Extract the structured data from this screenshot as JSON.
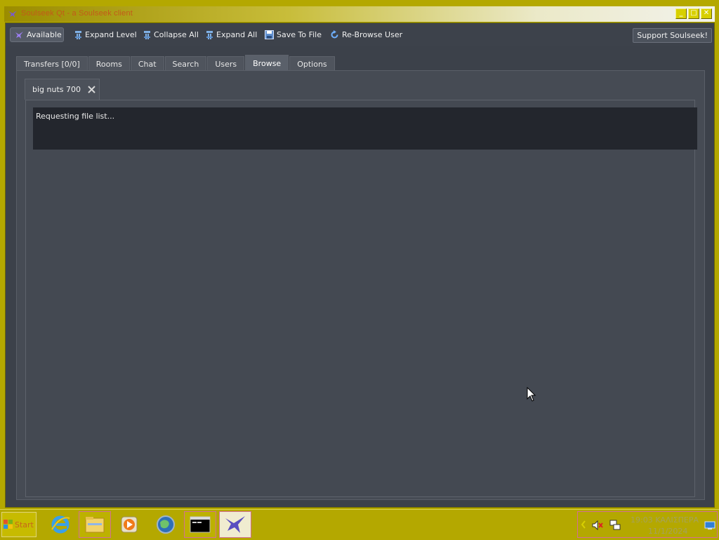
{
  "window": {
    "title": "Soulseek Qt - a Soulseek client",
    "min_label": "_",
    "max_label": "□",
    "close_label": "✕"
  },
  "toolbar": {
    "status_label": "Available",
    "expand_level": "Expand Level",
    "collapse_all": "Collapse All",
    "expand_all": "Expand All",
    "save_to_file": "Save To File",
    "rebrowse_user": "Re-Browse User",
    "support": "Support Soulseek!"
  },
  "tabs": [
    {
      "label": "Transfers [0/0]",
      "active": false
    },
    {
      "label": "Rooms",
      "active": false
    },
    {
      "label": "Chat",
      "active": false
    },
    {
      "label": "Search",
      "active": false
    },
    {
      "label": "Users",
      "active": false
    },
    {
      "label": "Browse",
      "active": true
    },
    {
      "label": "Options",
      "active": false
    }
  ],
  "browse": {
    "user_tab_label": "big nuts 700",
    "status_text": "Requesting file list..."
  },
  "taskbar": {
    "start_label": "Start",
    "clock_time": "19:03 ΚΑΛΙΣΠΕΡΑ",
    "clock_date": "11/1/2024"
  },
  "colors": {
    "desktop": "#b4a800",
    "app_bg": "#3c414a",
    "text_area": "#23262d",
    "title_text": "#c35a1a"
  }
}
